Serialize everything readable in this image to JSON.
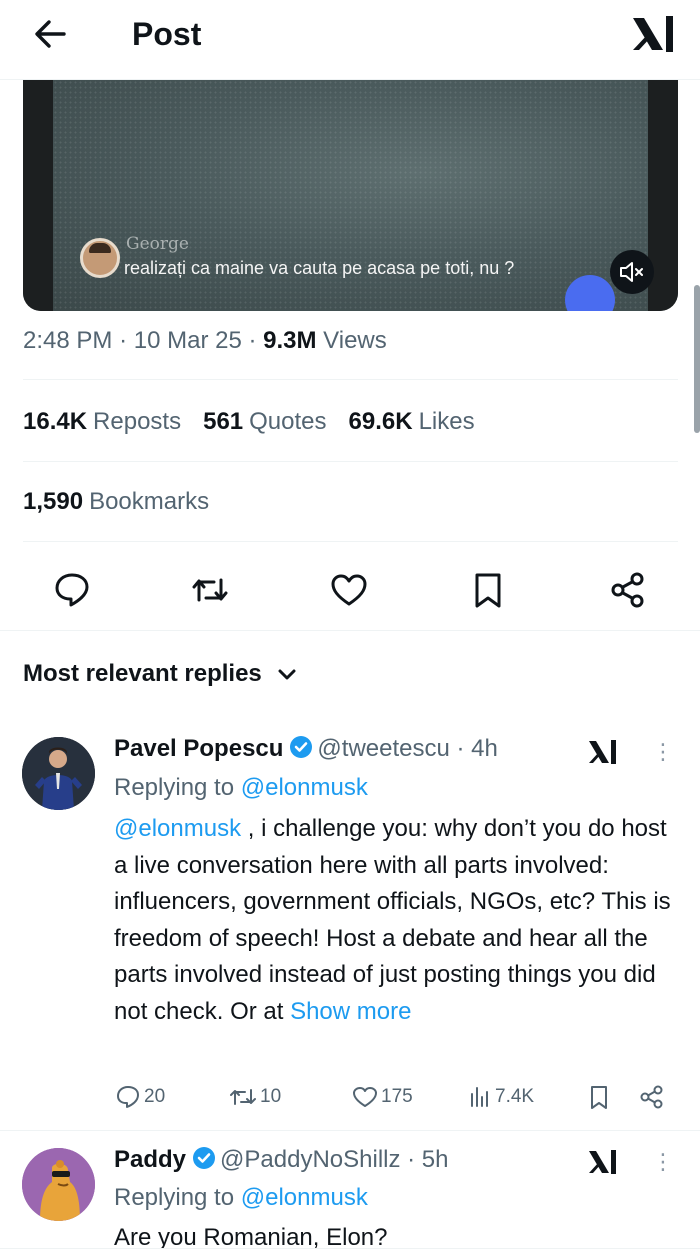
{
  "header": {
    "title": "Post",
    "back_icon": "arrow-left-icon",
    "logo_icon": "x-logo-icon"
  },
  "video": {
    "caption_name": "George",
    "caption_text": "realizați ca maine va cauta pe acasa pe toti, nu ?",
    "mute_icon": "speaker-muted-icon"
  },
  "post_meta": {
    "time": "2:48 PM",
    "date": "10 Mar 25",
    "views_count": "9.3M",
    "views_label": "Views",
    "sep": "·"
  },
  "stats": {
    "reposts": {
      "count": "16.4K",
      "label": "Reposts"
    },
    "quotes": {
      "count": "561",
      "label": "Quotes"
    },
    "likes": {
      "count": "69.6K",
      "label": "Likes"
    },
    "bookmarks": {
      "count": "1,590",
      "label": "Bookmarks"
    }
  },
  "actions": [
    "reply-icon",
    "repost-icon",
    "like-icon",
    "bookmark-icon",
    "share-icon"
  ],
  "replies_sort": {
    "label": "Most relevant replies"
  },
  "replies": [
    {
      "name": "Pavel Popescu",
      "handle": "@tweetescu · 4h",
      "replying_prefix": "Replying to",
      "replying_to": "@elonmusk",
      "mention": "@elonmusk",
      "text": " , i challenge you: why don’t you do host a live conversation here with all parts involved: influencers, government officials, NGOs, etc? This is freedom of speech! Host a debate and hear all the parts involved instead of just posting things you did not check. Or at ",
      "show_more": "Show more",
      "counts": {
        "replies": "20",
        "reposts": "10",
        "likes": "175",
        "views": "7.4K"
      }
    },
    {
      "name": "Paddy",
      "handle": "@PaddyNoShillz · 5h",
      "replying_prefix": "Replying to",
      "replying_to": "@elonmusk",
      "text": "Are you Romanian, Elon?"
    }
  ],
  "colors": {
    "accent": "#1d9bf0",
    "text": "#0f1419",
    "muted": "#536471",
    "divider": "#eff3f4"
  }
}
